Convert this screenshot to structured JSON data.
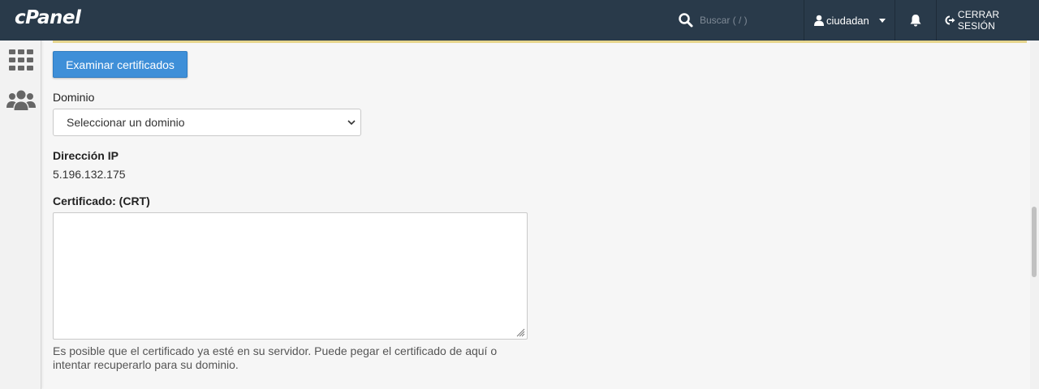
{
  "header": {
    "logo": "cPanel",
    "search_placeholder": "Buscar ( / )",
    "username": "ciudadan",
    "logout_label": "CERRAR SESIÓN"
  },
  "sidebar": {
    "items": [
      {
        "icon": "apps-grid-icon"
      },
      {
        "icon": "users-icon"
      }
    ]
  },
  "form": {
    "browse_button": "Examinar certificados",
    "domain_label": "Dominio",
    "domain_select_value": "Seleccionar un dominio",
    "ip_label": "Dirección IP",
    "ip_value": "5.196.132.175",
    "crt_label": "Certificado: (CRT)",
    "crt_value": "",
    "help_text": "Es posible que el certificado ya esté en su servidor. Puede pegar el certificado de aquí o intentar recuperarlo para su dominio."
  },
  "colors": {
    "header_bg": "#293a4a",
    "primary_button": "#3e8fd8",
    "page_bg": "#f6f6f6"
  }
}
